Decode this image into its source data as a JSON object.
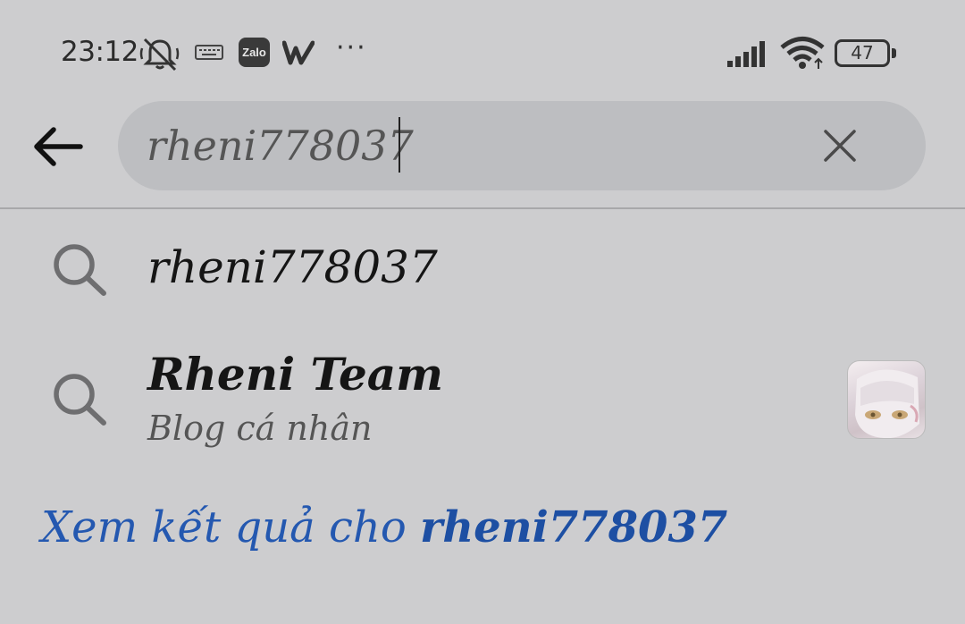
{
  "status_bar": {
    "time": "23:12",
    "zalo_label": "Zalo",
    "more": "···",
    "battery": "47",
    "icons": [
      "mute-bell-icon",
      "keyboard-icon",
      "zalo-icon",
      "w-app-icon",
      "more-icon",
      "signal-icon",
      "wifi-icon",
      "battery-icon"
    ]
  },
  "search": {
    "value": "rheni778037",
    "icons": [
      "back-arrow-icon",
      "clear-icon"
    ]
  },
  "suggestions": [
    {
      "text": "rheni778037",
      "icon": "search-icon"
    },
    {
      "title": "Rheni Team",
      "subtitle": "Blog cá nhân",
      "icon": "search-icon",
      "avatar": "page-avatar"
    }
  ],
  "see_results": {
    "prefix": "Xem kết quả cho ",
    "query": "rheni778037",
    "color": "#2458b0"
  }
}
